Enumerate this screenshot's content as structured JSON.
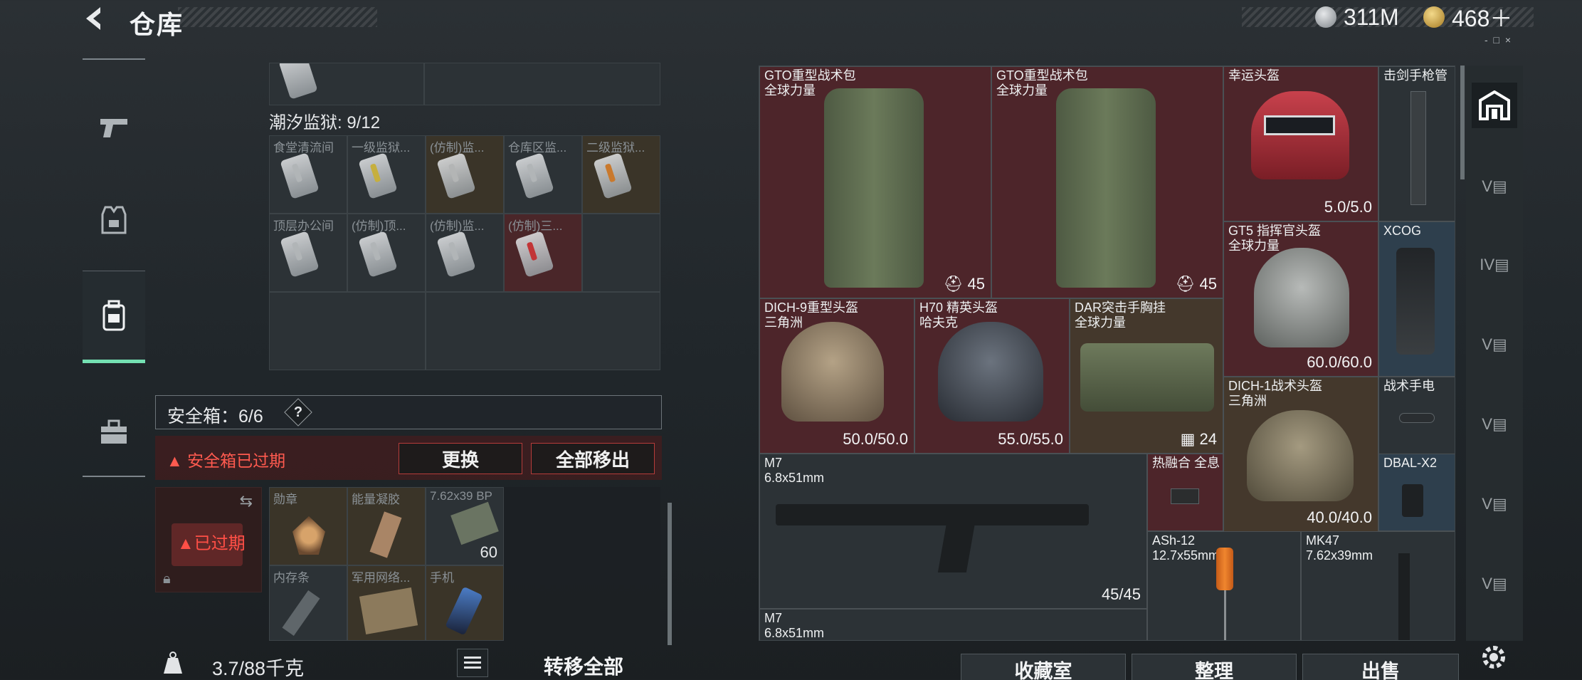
{
  "header": {
    "title": "仓库",
    "currency_silver": "311M",
    "currency_gold": "468＋"
  },
  "storage": {
    "top_label": "潮汐监狱: 9/12",
    "key_cells_row1": [
      "食堂清流间",
      "一级监狱...",
      "(仿制)监...",
      "仓库区监...",
      "二级监狱..."
    ],
    "key_cells_row2": [
      "顶层办公间",
      "(仿制)顶...",
      "(仿制)监...",
      "(仿制)三..."
    ]
  },
  "safebox": {
    "label": "安全箱：6/6",
    "help": "?",
    "warning": "安全箱已过期",
    "replace_button": "更换",
    "move_all_button": "全部移出",
    "expired_label": "已过期",
    "items": [
      {
        "name": "勋章"
      },
      {
        "name": "能量凝胶"
      },
      {
        "name": "7.62x39 BP",
        "count": "60"
      },
      {
        "name": "内存条"
      },
      {
        "name": "军用网络..."
      },
      {
        "name": "手机"
      }
    ]
  },
  "footer_left": {
    "weight": "3.7/88千克",
    "transfer_all": "转移全部"
  },
  "inventory": {
    "items": [
      {
        "name": "GTO重型战术包",
        "sub": "全球力量",
        "value": "45"
      },
      {
        "name": "GTO重型战术包",
        "sub": "全球力量",
        "value": "45"
      },
      {
        "name": "幸运头盔",
        "value": "5.0/5.0"
      },
      {
        "name": "击剑手枪管"
      },
      {
        "name": "GT5 指挥官头盔",
        "sub": "全球力量",
        "value": "60.0/60.0"
      },
      {
        "name": "XCOG"
      },
      {
        "name": "DICH-9重型头盔",
        "sub": "三角洲",
        "value": "50.0/50.0"
      },
      {
        "name": "H70 精英头盔",
        "sub": "哈夫克",
        "value": "55.0/55.0"
      },
      {
        "name": "DAR突击手胸挂",
        "sub": "全球力量",
        "value": "24"
      },
      {
        "name": "战术手电"
      },
      {
        "name": "DICH-1战术头盔",
        "sub": "三角洲",
        "value": "40.0/40.0"
      },
      {
        "name": "M7",
        "sub": "6.8x51mm",
        "value": "45/45"
      },
      {
        "name": "热融合 全息"
      },
      {
        "name": "DBAL-X2"
      },
      {
        "name": "ASh-12",
        "sub": "12.7x55mm"
      },
      {
        "name": "MK47",
        "sub": "7.62x39mm"
      },
      {
        "name": "M7",
        "sub": "6.8x51mm"
      }
    ]
  },
  "bottom_buttons": {
    "collection": "收藏室",
    "sort": "整理",
    "sell": "出售"
  },
  "colors": {
    "accent": "#74e0b2",
    "red_rarity": "#4d252a",
    "gold_rarity": "#44382c",
    "blue_rarity": "#2e3f4d",
    "warning": "#ff4f46"
  }
}
